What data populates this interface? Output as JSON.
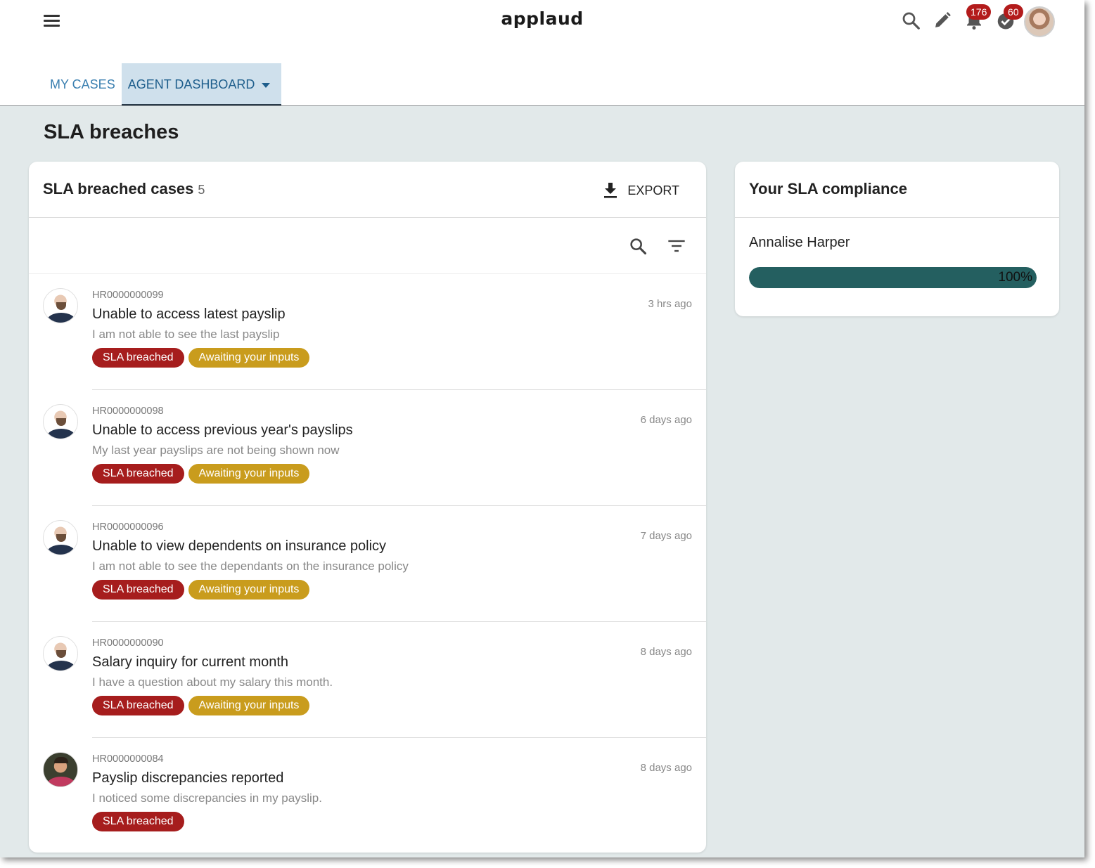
{
  "app": {
    "brand": "applaud"
  },
  "header": {
    "icons": [
      "menu-icon",
      "search-icon",
      "pencil-icon",
      "bell-icon",
      "check-circle-icon",
      "user-avatar"
    ],
    "notifications_count": "176",
    "tasks_count": "60"
  },
  "tabs": [
    {
      "label": "MY CASES",
      "active": false
    },
    {
      "label": "AGENT DASHBOARD",
      "active": true
    }
  ],
  "page": {
    "title": "SLA breaches"
  },
  "breached_cases": {
    "title": "SLA breached cases",
    "count": "5",
    "export_label": "EXPORT",
    "items": [
      {
        "id": "HR0000000099",
        "title": "Unable to access latest payslip",
        "description": "I am not able to see the last payslip",
        "time": "3 hrs ago",
        "tags": [
          "SLA breached",
          "Awaiting your inputs"
        ]
      },
      {
        "id": "HR0000000098",
        "title": "Unable to access previous year's payslips",
        "description": "My last year payslips are not being shown now",
        "time": "6 days ago",
        "tags": [
          "SLA breached",
          "Awaiting your inputs"
        ]
      },
      {
        "id": "HR0000000096",
        "title": "Unable to view dependents on insurance policy",
        "description": "I am not able to see the dependants on the insurance policy",
        "time": "7 days ago",
        "tags": [
          "SLA breached",
          "Awaiting your inputs"
        ]
      },
      {
        "id": "HR0000000090",
        "title": "Salary inquiry for current month",
        "description": "I have a question about my salary this month.",
        "time": "8 days ago",
        "tags": [
          "SLA breached",
          "Awaiting your inputs"
        ]
      },
      {
        "id": "HR0000000084",
        "title": "Payslip discrepancies reported",
        "description": "I noticed some discrepancies in my payslip.",
        "time": "8 days ago",
        "tags": [
          "SLA breached"
        ]
      }
    ]
  },
  "compliance": {
    "title": "Your SLA compliance",
    "person": "Annalise Harper",
    "percent_label": "100%",
    "percent": 100
  },
  "colors": {
    "accent": "#245f60",
    "tag_breached": "#a61d1d",
    "tag_awaiting": "#c99c1d",
    "tab_active_bg": "#cfe0ec",
    "badge": "#b31b1b"
  }
}
